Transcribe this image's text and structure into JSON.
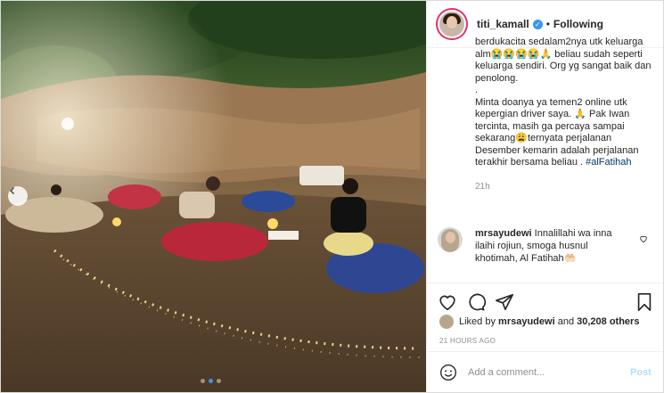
{
  "post": {
    "username": "titi_kamall",
    "verified": true,
    "separator": "•",
    "follow_label": "Following",
    "image_description_icon": "beach-night-photo",
    "carousel": {
      "current": 2,
      "total": 3
    }
  },
  "caption": {
    "lines": [
      "berdukacita sedalam2nya utk keluarga alm😭😭😭😭🙏 beliau sudah seperti keluarga sendiri. Org yg sangat baik dan penolong.",
      ".",
      "Minta doanya ya temen2 online utk kepergian driver saya. 🙏 Pak Iwan tercinta, masih ga percaya sampai sekarang😩ternyata perjalanan Desember kemarin adalah perjalanan terakhir bersama beliau ."
    ],
    "hashtag": "#alFatihah",
    "time": "21h"
  },
  "comment": {
    "username": "mrsayudewi",
    "text": "Innalillahi wa inna ilaihi rojiun, smoga husnul khotimah, Al Fatihah🤲🏻"
  },
  "likes": {
    "prefix": "Liked by",
    "user": "mrsayudewi",
    "and": "and",
    "count": "30,208 others"
  },
  "date": "21 HOURS AGO",
  "add_comment": {
    "placeholder": "Add a comment...",
    "post_label": "Post"
  },
  "colors": {
    "accent": "#3897f0",
    "post_disabled": "#b2dffc",
    "muted": "#8e8e8e"
  }
}
